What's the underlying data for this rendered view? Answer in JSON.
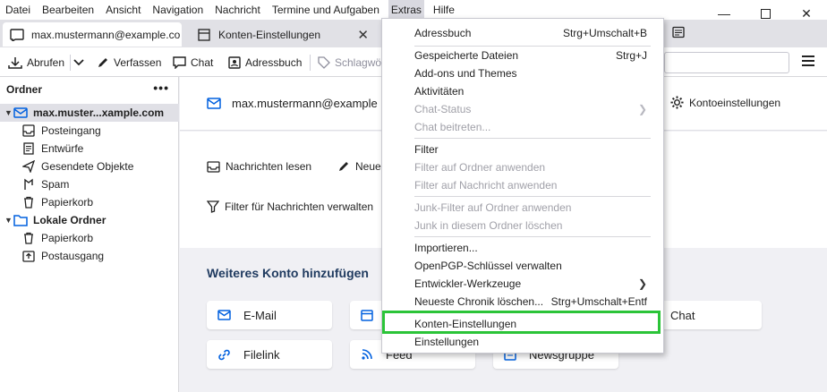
{
  "menubar": [
    "Datei",
    "Bearbeiten",
    "Ansicht",
    "Navigation",
    "Nachricht",
    "Termine und Aufgaben",
    "Extras",
    "Hilfe"
  ],
  "tabs": [
    {
      "label": "max.mustermann@example.co",
      "icon": "mail-tab-icon"
    },
    {
      "label": "Konten-Einstellungen",
      "icon": "settings-tab-icon"
    }
  ],
  "toolbar": {
    "abrufen": "Abrufen",
    "verfassen": "Verfassen",
    "chat": "Chat",
    "adressbuch": "Adressbuch",
    "schlagwoerter": "Schlagwö"
  },
  "folders": {
    "header": "Ordner",
    "account": "max.muster...xample.com",
    "items": [
      "Posteingang",
      "Entwürfe",
      "Gesendete Objekte",
      "Spam",
      "Papierkorb"
    ],
    "local": "Lokale Ordner",
    "local_items": [
      "Papierkorb",
      "Postausgang"
    ]
  },
  "main": {
    "account_title": "max.mustermann@example",
    "account_settings": "Kontoeinstellungen",
    "read_messages": "Nachrichten lesen",
    "new_message": "Neue",
    "manage_filters": "Filter für Nachrichten verwalten",
    "add_account_title": "Weiteres Konto hinzufügen",
    "cards": [
      "E-Mail",
      "Chat",
      "Filelink",
      "Feed",
      "Newsgruppe"
    ]
  },
  "dropdown": {
    "items": [
      {
        "label": "Adressbuch",
        "shortcut": "Strg+Umschalt+B",
        "disabled": false
      },
      {
        "label": "Gespeicherte Dateien",
        "shortcut": "Strg+J",
        "disabled": false
      },
      {
        "label": "Add-ons und Themes",
        "shortcut": "",
        "disabled": false
      },
      {
        "label": "Aktivitäten",
        "shortcut": "",
        "disabled": false
      },
      {
        "label": "Chat-Status",
        "shortcut": "",
        "disabled": true,
        "submenu": true
      },
      {
        "label": "Chat beitreten...",
        "shortcut": "",
        "disabled": true
      },
      {
        "label": "Filter",
        "shortcut": "",
        "disabled": false
      },
      {
        "label": "Filter auf Ordner anwenden",
        "shortcut": "",
        "disabled": true
      },
      {
        "label": "Filter auf Nachricht anwenden",
        "shortcut": "",
        "disabled": true
      },
      {
        "label": "Junk-Filter auf Ordner anwenden",
        "shortcut": "",
        "disabled": true
      },
      {
        "label": "Junk in diesem Ordner löschen",
        "shortcut": "",
        "disabled": true
      },
      {
        "label": "Importieren...",
        "shortcut": "",
        "disabled": false
      },
      {
        "label": "OpenPGP-Schlüssel verwalten",
        "shortcut": "",
        "disabled": false
      },
      {
        "label": "Entwickler-Werkzeuge",
        "shortcut": "",
        "disabled": false,
        "submenu": true
      },
      {
        "label": "Neueste Chronik löschen...",
        "shortcut": "Strg+Umschalt+Entf",
        "disabled": false
      },
      {
        "label": "Konten-Einstellungen",
        "shortcut": "",
        "disabled": false
      },
      {
        "label": "Einstellungen",
        "shortcut": "",
        "disabled": false
      }
    ]
  },
  "colors": {
    "accent": "#0060df",
    "highlight": "#2bc438"
  }
}
